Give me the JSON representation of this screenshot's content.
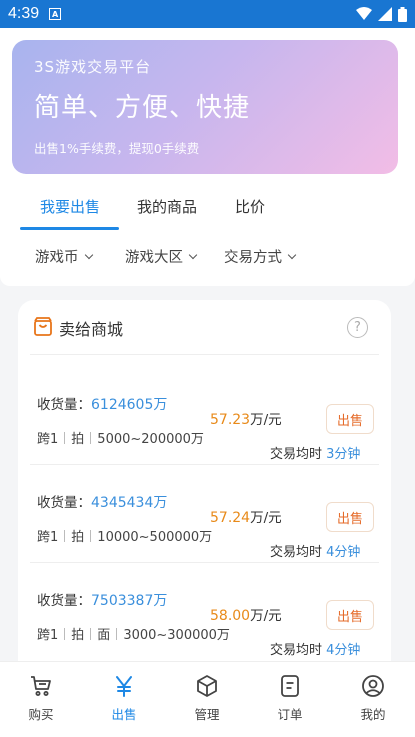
{
  "status_bar": {
    "time": "4:39",
    "notif_badge": "A"
  },
  "banner": {
    "platform": "3S游戏交易平台",
    "headline": "简单、方便、快捷",
    "fee_note": "出售1%手续费，提现0手续费"
  },
  "tabs": [
    {
      "label": "我要出售",
      "active": true
    },
    {
      "label": "我的商品",
      "active": false
    },
    {
      "label": "比价",
      "active": false
    }
  ],
  "filters": [
    {
      "label": "游戏币"
    },
    {
      "label": "游戏大区"
    },
    {
      "label": "交易方式"
    }
  ],
  "section": {
    "title": "卖给商城",
    "help": "?"
  },
  "listing_labels": {
    "qty_prefix": "收货量：",
    "qty_unit": "万",
    "price_unit": "万/元",
    "avg_prefix": "交易均时",
    "sell": "出售"
  },
  "listings": [
    {
      "qty": "6124605",
      "price": "57.23",
      "tags": [
        "跨1",
        "拍"
      ],
      "range": "5000~200000万",
      "avg_time": "3分钟"
    },
    {
      "qty": "4345434",
      "price": "57.24",
      "tags": [
        "跨1",
        "拍"
      ],
      "range": "10000~500000万",
      "avg_time": "4分钟"
    },
    {
      "qty": "7503387",
      "price": "58.00",
      "tags": [
        "跨1",
        "拍",
        "面"
      ],
      "range": "3000~300000万",
      "avg_time": "4分钟"
    }
  ],
  "bottom_nav": [
    {
      "label": "购买",
      "icon": "cart-icon",
      "active": false
    },
    {
      "label": "出售",
      "icon": "yen-icon",
      "active": true
    },
    {
      "label": "管理",
      "icon": "box-icon",
      "active": false
    },
    {
      "label": "订单",
      "icon": "order-icon",
      "active": false
    },
    {
      "label": "我的",
      "icon": "profile-icon",
      "active": false
    }
  ],
  "colors": {
    "primary": "#1e88e5",
    "status_bar": "#1976d2",
    "price": "#e88a1a",
    "sell": "#e56b2a"
  }
}
